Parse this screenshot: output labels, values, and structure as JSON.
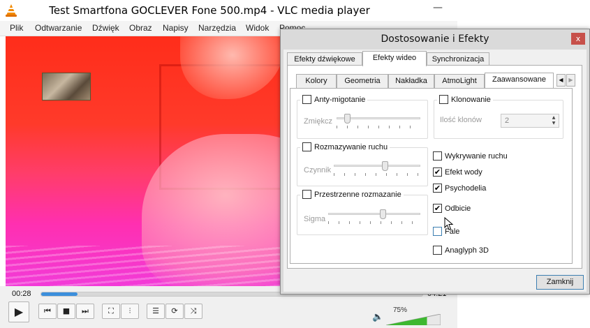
{
  "vlc": {
    "title": "Test Smartfona GOCLEVER Fone 500.mp4 - VLC media player",
    "window_controls": {
      "minimize": "—"
    },
    "menu": [
      "Plik",
      "Odtwarzanie",
      "Dźwięk",
      "Obraz",
      "Napisy",
      "Narzędzia",
      "Widok",
      "Pomoc"
    ],
    "time_elapsed": "00:28",
    "time_total": "04:21",
    "progress_fraction": 0.095,
    "volume_percent": "75%",
    "volume_fraction": 0.75,
    "icons": {
      "play": "▶",
      "prev": "⏮",
      "stop": "■",
      "next": "⏭",
      "fullscreen": "⛶",
      "equalizer": "⫶",
      "playlist": "☰",
      "loop": "⟳",
      "shuffle": "⤨",
      "volume": "🔈"
    }
  },
  "dialog": {
    "title": "Dostosowanie i Efekty",
    "close_icon": "x",
    "top_tabs": [
      "Efekty dźwiękowe",
      "Efekty wideo",
      "Synchronizacja"
    ],
    "sub_tabs": [
      "Kolory",
      "Geometria",
      "Nakładka",
      "AtmoLight",
      "Zaawansowane"
    ],
    "scroll_left": "◀",
    "scroll_right": "▶",
    "groups": {
      "antiflicker": {
        "label": "Anty-migotanie",
        "checked": false,
        "param": "Zmiękcz",
        "value_fraction": 0.1
      },
      "motionblur": {
        "label": "Rozmazywanie ruchu",
        "checked": false,
        "param": "Czynnik",
        "value_fraction": 0.6
      },
      "spatialblur": {
        "label": "Przestrzenne rozmazanie",
        "checked": false,
        "param": "Sigma",
        "value_fraction": 0.6
      },
      "clone": {
        "label": "Klonowanie",
        "checked": false,
        "param": "Ilość klonów",
        "value": "2"
      }
    },
    "checkboxes": {
      "motion_detect": {
        "label": "Wykrywanie ruchu",
        "checked": false
      },
      "water": {
        "label": "Efekt wody",
        "checked": true
      },
      "psychedelic": {
        "label": "Psychodelia",
        "checked": true
      },
      "mirror": {
        "label": "Odbicie",
        "checked": true
      },
      "waves": {
        "label": "Fale",
        "checked": false
      },
      "anaglyph": {
        "label": "Anaglyph 3D",
        "checked": false
      }
    },
    "check_mark": "✔",
    "close_button": "Zamknij"
  }
}
